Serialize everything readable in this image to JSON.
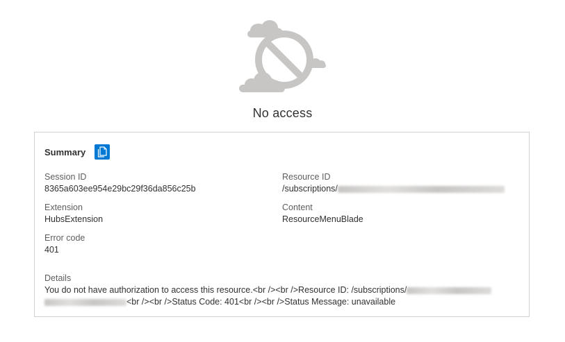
{
  "header": {
    "title": "No access"
  },
  "summary": {
    "label": "Summary",
    "copy_icon": "copy-icon",
    "fields": {
      "session_id": {
        "label": "Session ID",
        "value": "8365a603ee954e29bc29f36da856c25b"
      },
      "resource_id": {
        "label": "Resource ID",
        "value_prefix": "/subscriptions/"
      },
      "extension": {
        "label": "Extension",
        "value": "HubsExtension"
      },
      "content": {
        "label": "Content",
        "value": "ResourceMenuBlade"
      },
      "error_code": {
        "label": "Error code",
        "value": "401"
      }
    },
    "details": {
      "label": "Details",
      "line1_prefix": "You do not have authorization to access this resource.<br /><br />Resource ID: /subscriptions/",
      "line2_suffix": "<br /><br />Status Code: 401<br /><br />Status Message: unavailable"
    }
  },
  "colors": {
    "accent": "#0078d4",
    "border": "#d2d0ce",
    "text": "#323130",
    "label": "#605e5c",
    "illustration": "#c8c6c4"
  }
}
